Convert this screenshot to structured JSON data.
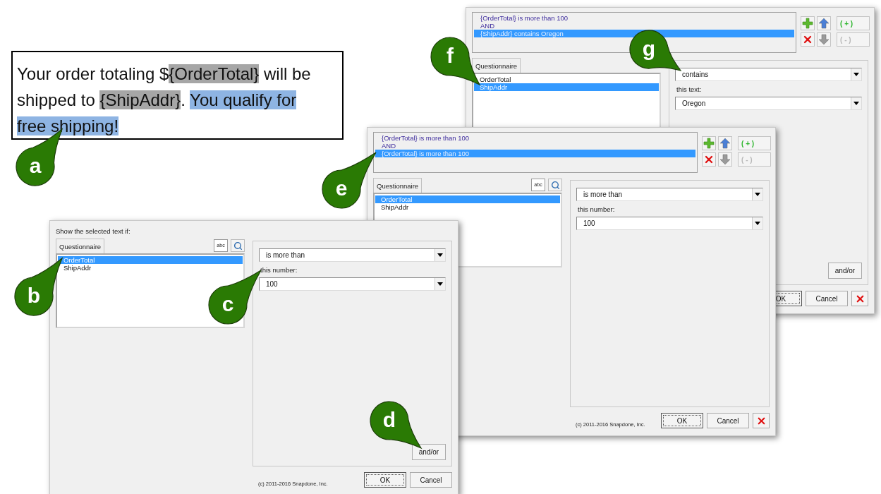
{
  "document_text": {
    "segments": [
      {
        "text": "Your order totaling $",
        "kind": "plain"
      },
      {
        "text": "{OrderTotal}",
        "kind": "field"
      },
      {
        "text": " will be shipped to ",
        "kind": "plain"
      },
      {
        "text": "{ShipAddr}",
        "kind": "field"
      },
      {
        "text": ". ",
        "kind": "plain"
      },
      {
        "text": "You qualify for free shipping!",
        "kind": "selection"
      }
    ]
  },
  "dialogs": [
    {
      "conditions": [
        {
          "text": "{OrderTotal} is more than 100",
          "selected": false
        },
        {
          "text": "AND",
          "selected": false
        },
        {
          "text": "{ShipAddr} contains Oregon",
          "selected": true
        }
      ],
      "tools": [
        {
          "kind": "add",
          "disabled": false
        },
        {
          "kind": "up",
          "disabled": false
        },
        {
          "kind": "delete",
          "disabled": false
        },
        {
          "kind": "down",
          "disabled": true
        }
      ],
      "paren_buttons": [
        {
          "open": "(",
          "sign": "+",
          "close": ")",
          "disabled": false
        },
        {
          "open": "(",
          "sign": "-",
          "close": ")",
          "disabled": true
        }
      ],
      "tab": "Questionnaire",
      "fields": [
        {
          "label": "OrderTotal",
          "selected": false
        },
        {
          "label": "ShipAddr",
          "selected": true
        }
      ],
      "operator": "contains",
      "value_label": "this text:",
      "value": "Oregon",
      "and_or": "and/or",
      "ok": "OK",
      "cancel": "Cancel",
      "close_button": true
    },
    {
      "conditions": [
        {
          "text": "{OrderTotal} is more than 100",
          "selected": false
        },
        {
          "text": "AND",
          "selected": false
        },
        {
          "text": "{OrderTotal} is more than 100",
          "selected": true
        }
      ],
      "tools": [
        {
          "kind": "add",
          "disabled": false
        },
        {
          "kind": "up",
          "disabled": false
        },
        {
          "kind": "delete",
          "disabled": false
        },
        {
          "kind": "down",
          "disabled": true
        }
      ],
      "paren_buttons": [
        {
          "open": "(",
          "sign": "+",
          "close": ")",
          "disabled": false
        },
        {
          "open": "(",
          "sign": "-",
          "close": ")",
          "disabled": true
        }
      ],
      "tab": "Questionnaire",
      "search_tools": {
        "abc": "abc"
      },
      "fields": [
        {
          "label": "OrderTotal",
          "selected": true
        },
        {
          "label": "ShipAddr",
          "selected": false
        }
      ],
      "operator": "is more than",
      "value_label": "this number:",
      "value": "100",
      "copyright": "(c) 2011-2016 Snapdone, Inc.",
      "ok": "OK",
      "cancel": "Cancel",
      "close_button": true
    },
    {
      "prompt": "Show the selected text if:",
      "tab": "Questionnaire",
      "search_tools": {
        "abc": "abc"
      },
      "fields": [
        {
          "label": "OrderTotal",
          "selected": true
        },
        {
          "label": "ShipAddr",
          "selected": false
        }
      ],
      "operator": "is more than",
      "value_label": "this number:",
      "value": "100",
      "and_or": "and/or",
      "copyright": "(c) 2011-2016 Snapdone, Inc.",
      "ok": "OK",
      "cancel": "Cancel",
      "close_button": false
    }
  ],
  "callouts": [
    {
      "letter": "a"
    },
    {
      "letter": "b"
    },
    {
      "letter": "c"
    },
    {
      "letter": "d"
    },
    {
      "letter": "e"
    },
    {
      "letter": "f"
    },
    {
      "letter": "g"
    }
  ]
}
